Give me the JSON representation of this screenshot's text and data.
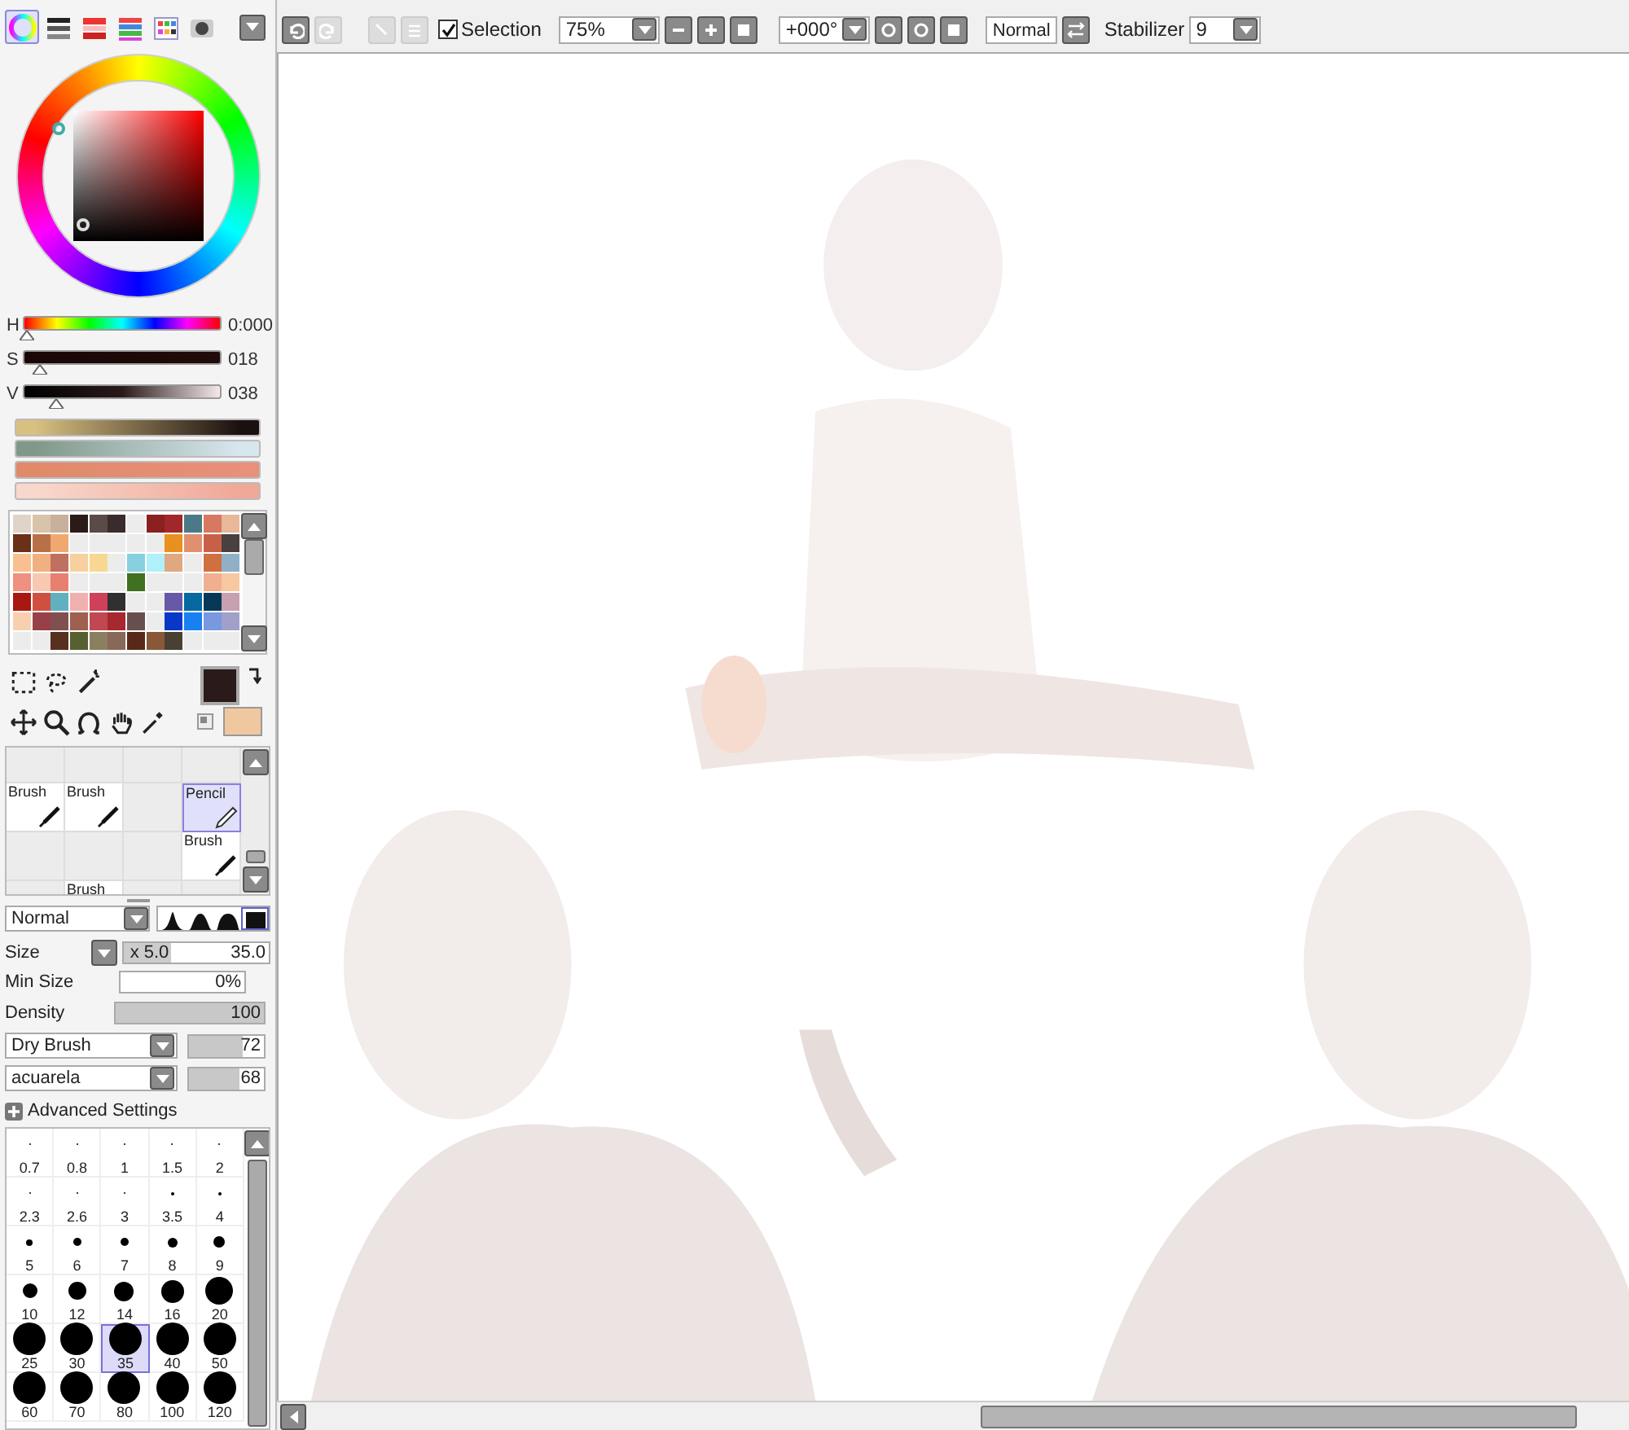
{
  "color_panel": {
    "tabs": [
      {
        "selected": true
      },
      {
        "selected": false
      },
      {
        "selected": false
      },
      {
        "selected": false
      },
      {
        "selected": false
      },
      {
        "selected": false
      }
    ],
    "hsv": [
      {
        "label": "H",
        "value": "0:000",
        "level": 0
      },
      {
        "label": "S",
        "value": "018",
        "level": 0.07
      },
      {
        "label": "V",
        "value": "038",
        "level": 0.15
      }
    ]
  },
  "swatches": [
    {
      "color": "#e0d4c8"
    },
    {
      "color": "#d8c4aa"
    },
    {
      "color": "#c8b09c"
    },
    {
      "color": "#2a1a18"
    },
    {
      "color": "#5a4a48"
    },
    {
      "color": "#3a2c2c"
    },
    {
      "kind": "empty"
    },
    {
      "color": "#8a2020"
    },
    {
      "color": "#a02828"
    },
    {
      "color": "#4a7a88"
    },
    {
      "color": "#d87860"
    },
    {
      "color": "#e8b898"
    },
    {
      "color": "#6a3018"
    },
    {
      "color": "#b87048"
    },
    {
      "color": "#f0a870"
    },
    {
      "kind": "empty"
    },
    {
      "kind": "empty"
    },
    {
      "kind": "empty"
    },
    {
      "kind": "empty"
    },
    {
      "kind": "empty"
    },
    {
      "color": "#e89020"
    },
    {
      "color": "#e09070"
    },
    {
      "color": "#c86048"
    },
    {
      "color": "#4a4040"
    },
    {
      "color": "#f8c090"
    },
    {
      "color": "#f0b080"
    },
    {
      "color": "#c07060"
    },
    {
      "color": "#f8d0a0"
    },
    {
      "color": "#f8d890"
    },
    {
      "kind": "empty"
    },
    {
      "color": "#88d0e0"
    },
    {
      "color": "#b0f0f8"
    },
    {
      "color": "#e0a880"
    },
    {
      "kind": "empty"
    },
    {
      "color": "#d07040"
    },
    {
      "color": "#90b0c8"
    },
    {
      "color": "#f09080"
    },
    {
      "color": "#f8c8b0"
    },
    {
      "color": "#e88070"
    },
    {
      "kind": "empty"
    },
    {
      "kind": "empty"
    },
    {
      "kind": "empty"
    },
    {
      "color": "#407020"
    },
    {
      "kind": "empty"
    },
    {
      "kind": "empty"
    },
    {
      "kind": "empty"
    },
    {
      "color": "#f0b090"
    },
    {
      "color": "#f8c8a0"
    },
    {
      "color": "#a81810"
    },
    {
      "color": "#d05040"
    },
    {
      "color": "#60b0c0"
    },
    {
      "color": "#f0b0b0"
    },
    {
      "color": "#d04058"
    },
    {
      "color": "#303030"
    },
    {
      "kind": "empty"
    },
    {
      "kind": "empty"
    },
    {
      "color": "#6858a8"
    },
    {
      "color": "#0868a0"
    },
    {
      "color": "#083858"
    },
    {
      "color": "#c8a0b0"
    },
    {
      "color": "#f8d0b0"
    },
    {
      "color": "#984048"
    },
    {
      "color": "#805050"
    },
    {
      "color": "#a06050"
    },
    {
      "color": "#c04850"
    },
    {
      "color": "#a82830"
    },
    {
      "color": "#685050"
    },
    {
      "kind": "empty"
    },
    {
      "color": "#0838c8"
    },
    {
      "color": "#1880f0"
    },
    {
      "color": "#7898e0"
    },
    {
      "color": "#a0a0c8"
    },
    {
      "kind": "empty"
    },
    {
      "kind": "empty"
    },
    {
      "color": "#583020"
    },
    {
      "color": "#586030"
    },
    {
      "color": "#8a8060"
    },
    {
      "color": "#886858"
    },
    {
      "color": "#582818"
    },
    {
      "color": "#885838"
    },
    {
      "color": "#484030"
    },
    {
      "kind": "empty"
    },
    {
      "kind": "empty"
    },
    {
      "kind": "empty"
    }
  ],
  "current_colors": {
    "primary": {
      "color": "#2a1a1a"
    },
    "secondary": {
      "color": "#f0c8a0"
    }
  },
  "brush_slots": [
    {
      "kind": "empty"
    },
    {
      "kind": "empty"
    },
    {
      "kind": "empty"
    },
    {
      "kind": "empty"
    },
    {
      "kind": "brush",
      "label": "Brush",
      "selected": false
    },
    {
      "kind": "brush",
      "label": "Brush",
      "selected": false
    },
    {
      "kind": "empty"
    },
    {
      "kind": "pencil",
      "label": "Pencil",
      "selected": true
    },
    {
      "kind": "empty"
    },
    {
      "kind": "empty"
    },
    {
      "kind": "empty"
    },
    {
      "kind": "brush",
      "label": "Brush",
      "selected": false
    },
    {
      "kind": "empty"
    },
    {
      "kind": "brush",
      "label": "Brush",
      "selected": false
    },
    {
      "kind": "empty"
    },
    {
      "kind": "empty"
    }
  ],
  "brush_settings": {
    "blend_mode": "Normal",
    "shapes": [
      {
        "selected": false
      },
      {
        "selected": false
      },
      {
        "selected": false
      },
      {
        "selected": true
      }
    ],
    "size": {
      "label": "Size",
      "multiplier": "x 5.0",
      "value": "35.0"
    },
    "min_size": {
      "label": "Min Size",
      "value": "0%"
    },
    "density": {
      "label": "Density",
      "value": "100",
      "level": 1
    },
    "texture_rows": [
      {
        "name": "Dry Brush",
        "value": "72",
        "level": 0.72
      },
      {
        "name": "acuarela",
        "value": "68",
        "level": 0.68
      }
    ],
    "advanced": "Advanced Settings"
  },
  "brush_sizes": [
    {
      "label": "0.7",
      "selected": false
    },
    {
      "label": "0.8",
      "selected": false
    },
    {
      "label": "1",
      "selected": false
    },
    {
      "label": "1.5",
      "selected": false
    },
    {
      "label": "2",
      "selected": false
    },
    {
      "label": "2.3",
      "selected": false
    },
    {
      "label": "2.6",
      "selected": false
    },
    {
      "label": "3",
      "selected": false
    },
    {
      "label": "3.5",
      "selected": false
    },
    {
      "label": "4",
      "selected": false
    },
    {
      "label": "5",
      "selected": false
    },
    {
      "label": "6",
      "selected": false
    },
    {
      "label": "7",
      "selected": false
    },
    {
      "label": "8",
      "selected": false
    },
    {
      "label": "9",
      "selected": false
    },
    {
      "label": "10",
      "selected": false
    },
    {
      "label": "12",
      "selected": false
    },
    {
      "label": "14",
      "selected": false
    },
    {
      "label": "16",
      "selected": false
    },
    {
      "label": "20",
      "selected": false
    },
    {
      "label": "25",
      "selected": false
    },
    {
      "label": "30",
      "selected": false
    },
    {
      "label": "35",
      "selected": true
    },
    {
      "label": "40",
      "selected": false
    },
    {
      "label": "50",
      "selected": false
    },
    {
      "label": "60",
      "selected": false
    },
    {
      "label": "70",
      "selected": false
    },
    {
      "label": "80",
      "selected": false
    },
    {
      "label": "100",
      "selected": false
    },
    {
      "label": "120",
      "selected": false
    }
  ],
  "toolbar": {
    "selection": {
      "label": "Selection",
      "checked": true
    },
    "zoom": "75%",
    "angle": "+000°",
    "blend": "Normal",
    "stabilizer": {
      "label": "Stabilizer",
      "value": "9"
    }
  }
}
